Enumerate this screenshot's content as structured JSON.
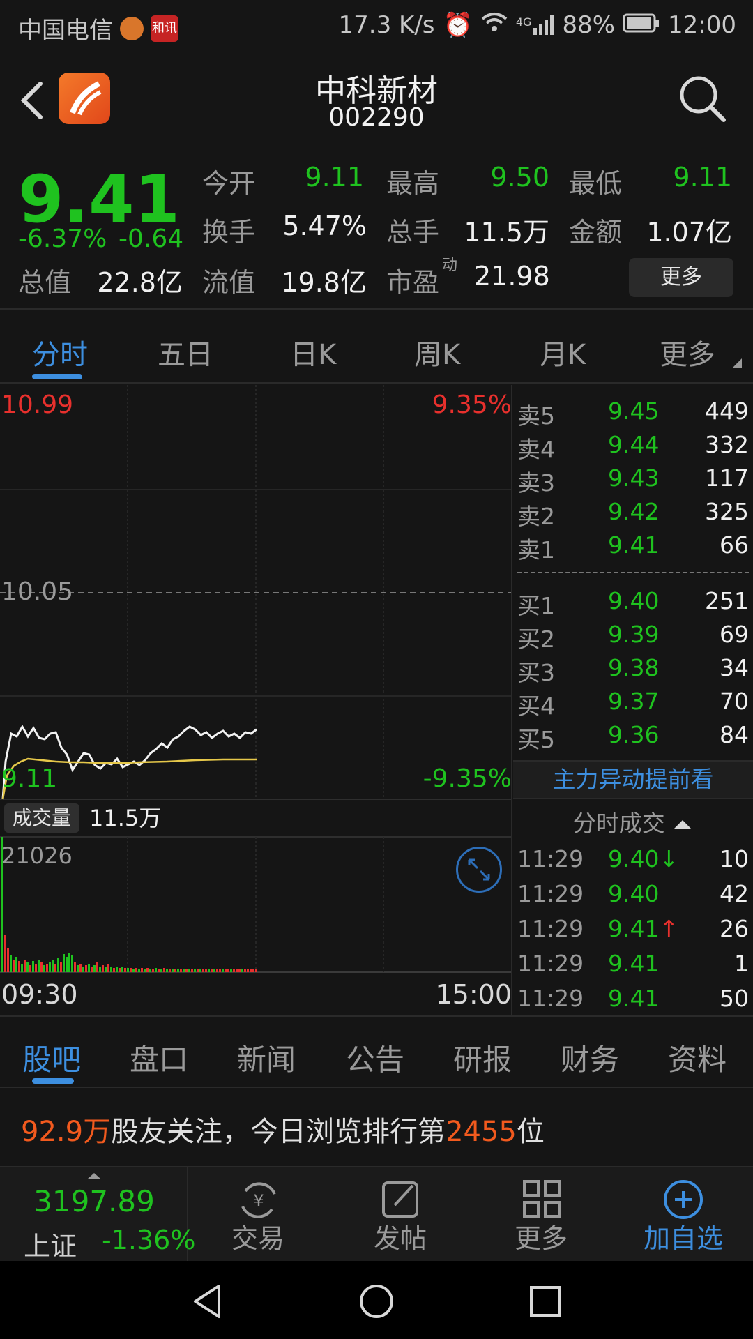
{
  "status_bar": {
    "carrier": "中国电信",
    "badge2_text": "和讯",
    "speed": "17.3 K/s",
    "net": "4G",
    "battery": "88%",
    "time": "12:00"
  },
  "header": {
    "title": "中科新材",
    "code": "002290"
  },
  "quote": {
    "price": "9.41",
    "change_pct": "-6.37%",
    "change_val": "-0.64",
    "open_label": "今开",
    "open": "9.11",
    "high_label": "最高",
    "high": "9.50",
    "low_label": "最低",
    "low": "9.11",
    "turnover_label": "换手",
    "turnover": "5.47%",
    "volume_label": "总手",
    "volume": "11.5万",
    "amount_label": "金额",
    "amount": "1.07亿",
    "total_cap_label": "总值",
    "total_cap": "22.8亿",
    "float_cap_label": "流值",
    "float_cap": "19.8亿",
    "pe_label": "市盈",
    "pe_sup": "动",
    "pe": "21.98",
    "more_button": "更多"
  },
  "period_tabs": [
    "分时",
    "五日",
    "日K",
    "周K",
    "月K",
    "更多"
  ],
  "chart": {
    "price_top": "10.99",
    "pct_top": "9.35%",
    "price_mid": "10.05",
    "price_bottom": "9.11",
    "pct_bottom": "-9.35%",
    "volume_badge": "成交量",
    "volume_total": "11.5万",
    "volume_max": "21026",
    "time_start": "09:30",
    "time_end": "15:00"
  },
  "orderbook": {
    "asks": [
      {
        "label": "卖5",
        "price": "9.45",
        "vol": "449"
      },
      {
        "label": "卖4",
        "price": "9.44",
        "vol": "332"
      },
      {
        "label": "卖3",
        "price": "9.43",
        "vol": "117"
      },
      {
        "label": "卖2",
        "price": "9.42",
        "vol": "325"
      },
      {
        "label": "卖1",
        "price": "9.41",
        "vol": "66"
      }
    ],
    "bids": [
      {
        "label": "买1",
        "price": "9.40",
        "vol": "251"
      },
      {
        "label": "买2",
        "price": "9.39",
        "vol": "69"
      },
      {
        "label": "买3",
        "price": "9.38",
        "vol": "34"
      },
      {
        "label": "买4",
        "price": "9.37",
        "vol": "70"
      },
      {
        "label": "买5",
        "price": "9.36",
        "vol": "84"
      }
    ],
    "promo_link": "主力异动提前看",
    "ticks_title": "分时成交",
    "ticks": [
      {
        "time": "11:29",
        "price": "9.40",
        "arrow": "↓",
        "vol": "10",
        "vol_color": "green"
      },
      {
        "time": "11:29",
        "price": "9.40",
        "arrow": "",
        "vol": "42",
        "vol_color": "green"
      },
      {
        "time": "11:29",
        "price": "9.41",
        "arrow": "↑",
        "vol": "26",
        "vol_color": "red"
      },
      {
        "time": "11:29",
        "price": "9.41",
        "arrow": "",
        "vol": "1",
        "vol_color": "red"
      },
      {
        "time": "11:29",
        "price": "9.41",
        "arrow": "",
        "vol": "50",
        "vol_color": "red"
      }
    ]
  },
  "news_tabs": [
    "股吧",
    "盘口",
    "新闻",
    "公告",
    "研报",
    "财务",
    "资料"
  ],
  "follow": {
    "count": "92.9万",
    "text1": "股友关注，今日浏览排行第",
    "rank": "2455",
    "text2": "位"
  },
  "bottom_bar": {
    "index_value": "3197.89",
    "index_name": "上证",
    "index_change": "-1.36%",
    "trade": "交易",
    "post": "发帖",
    "more": "更多",
    "add_watch": "加自选"
  },
  "colors": {
    "up": "#e8302d",
    "down": "#1fc21f",
    "accent": "#3d8fe0",
    "highlight": "#f25a1e"
  }
}
